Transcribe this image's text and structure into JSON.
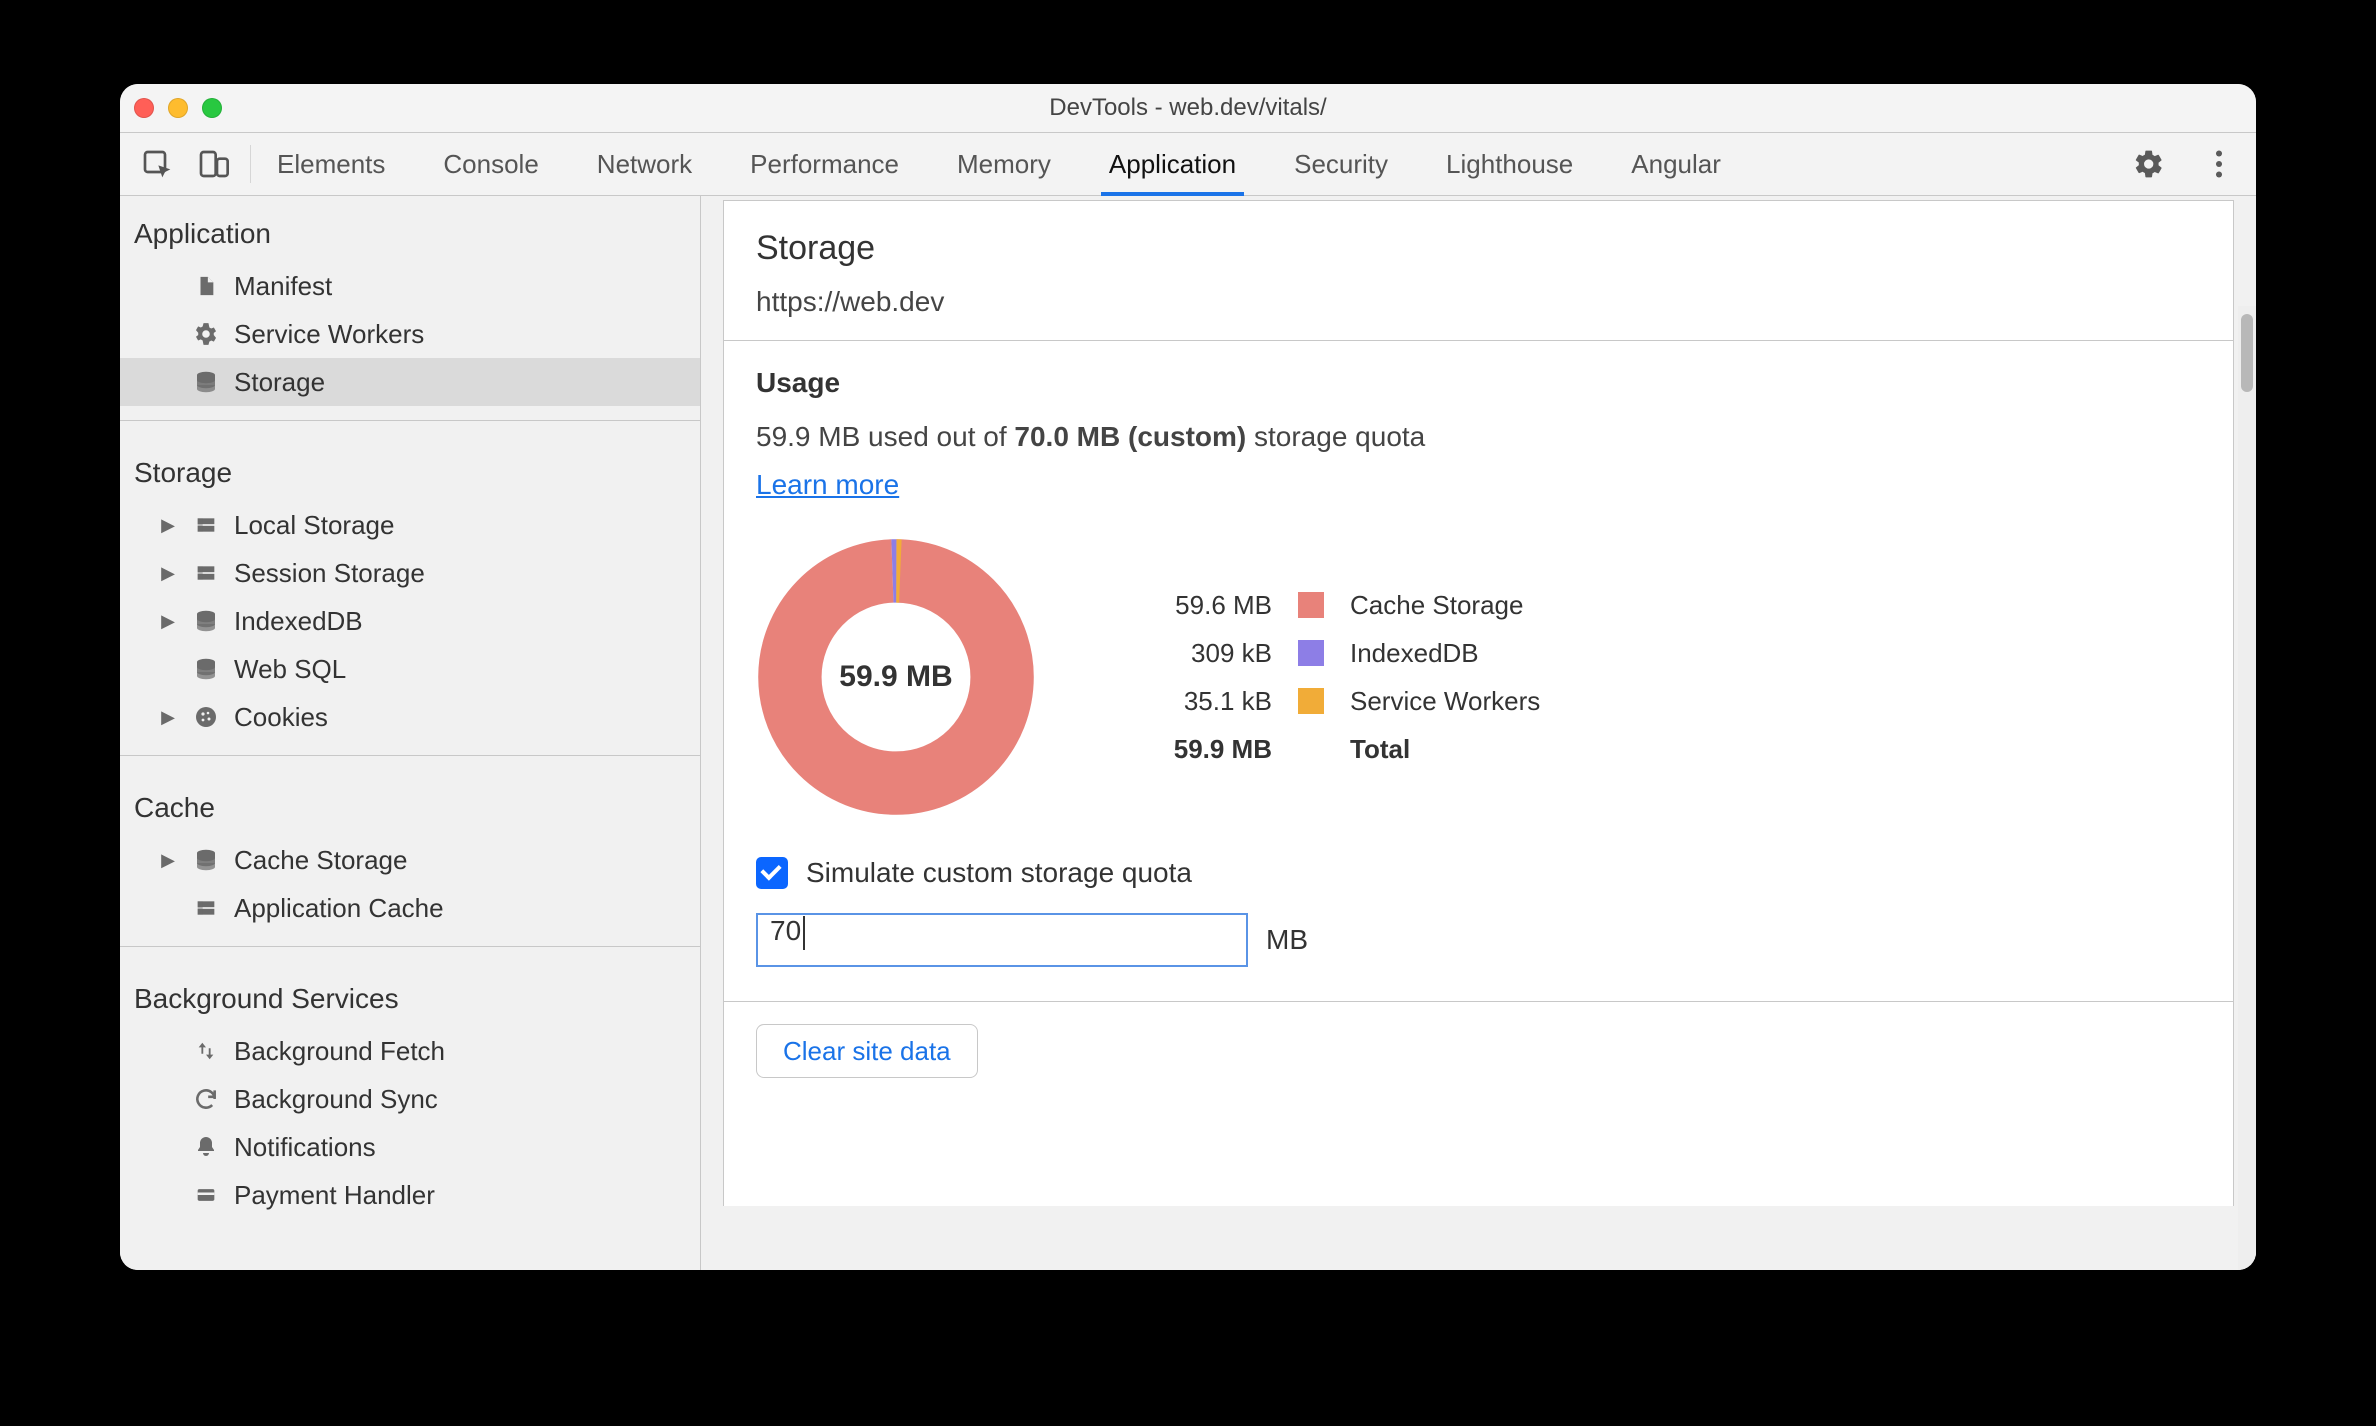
{
  "window": {
    "title": "DevTools - web.dev/vitals/"
  },
  "toolbar": {
    "tabs": [
      "Elements",
      "Console",
      "Network",
      "Performance",
      "Memory",
      "Application",
      "Security",
      "Lighthouse",
      "Angular"
    ],
    "active_tab": "Application"
  },
  "sidebar": {
    "groups": [
      {
        "title": "Application",
        "items": [
          {
            "label": "Manifest",
            "icon": "file-icon",
            "expandable": false
          },
          {
            "label": "Service Workers",
            "icon": "gear-icon",
            "expandable": false
          },
          {
            "label": "Storage",
            "icon": "db-icon",
            "expandable": false,
            "selected": true
          }
        ]
      },
      {
        "title": "Storage",
        "items": [
          {
            "label": "Local Storage",
            "icon": "grid-icon",
            "expandable": true
          },
          {
            "label": "Session Storage",
            "icon": "grid-icon",
            "expandable": true
          },
          {
            "label": "IndexedDB",
            "icon": "db-icon",
            "expandable": true
          },
          {
            "label": "Web SQL",
            "icon": "db-icon",
            "expandable": false
          },
          {
            "label": "Cookies",
            "icon": "cookie-icon",
            "expandable": true
          }
        ]
      },
      {
        "title": "Cache",
        "items": [
          {
            "label": "Cache Storage",
            "icon": "db-icon",
            "expandable": true
          },
          {
            "label": "Application Cache",
            "icon": "grid-icon",
            "expandable": false
          }
        ]
      },
      {
        "title": "Background Services",
        "items": [
          {
            "label": "Background Fetch",
            "icon": "updown-icon",
            "expandable": false
          },
          {
            "label": "Background Sync",
            "icon": "sync-icon",
            "expandable": false
          },
          {
            "label": "Notifications",
            "icon": "bell-icon",
            "expandable": false
          },
          {
            "label": "Payment Handler",
            "icon": "card-icon",
            "expandable": false
          }
        ]
      }
    ]
  },
  "storage": {
    "heading": "Storage",
    "origin": "https://web.dev",
    "usage_title": "Usage",
    "usage_used": "59.9 MB",
    "usage_used_suffix": " used out of ",
    "usage_quota": "70.0 MB (custom)",
    "usage_quota_suffix": " storage quota",
    "learn_more": "Learn more",
    "donut_center": "59.9 MB",
    "legend": [
      {
        "value": "59.6 MB",
        "color": "#e8827a",
        "name": "Cache Storage"
      },
      {
        "value": "309 kB",
        "color": "#8d7ee6",
        "name": "IndexedDB"
      },
      {
        "value": "35.1 kB",
        "color": "#f1ac38",
        "name": "Service Workers"
      }
    ],
    "legend_total_value": "59.9 MB",
    "legend_total_name": "Total",
    "simulate_label": "Simulate custom storage quota",
    "quota_value": "70",
    "quota_unit": "MB",
    "clear_button": "Clear site data"
  },
  "chart_data": {
    "type": "pie",
    "title": "Storage usage breakdown",
    "total_label": "59.9 MB",
    "series": [
      {
        "name": "Cache Storage",
        "value_bytes": 59600000,
        "display": "59.6 MB",
        "color": "#e8827a"
      },
      {
        "name": "IndexedDB",
        "value_bytes": 309000,
        "display": "309 kB",
        "color": "#8d7ee6"
      },
      {
        "name": "Service Workers",
        "value_bytes": 35100,
        "display": "35.1 kB",
        "color": "#f1ac38"
      }
    ],
    "quota_bytes": 70000000,
    "quota_display": "70.0 MB (custom)"
  }
}
